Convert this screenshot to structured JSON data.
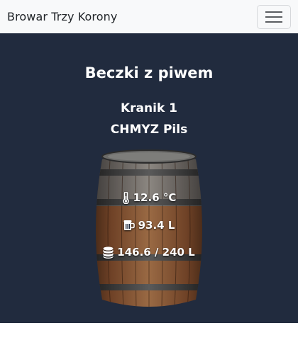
{
  "navbar": {
    "brand": "Browar Trzy Korony",
    "toggle_icon": "hamburger-menu-icon"
  },
  "main": {
    "title": "Beczki z piwem",
    "tap": {
      "name": "Kranik 1",
      "beer": "CHMYZ Pils",
      "temperature": "12.6 °C",
      "volume": "93.4 L",
      "capacity": "146.6 / 240 L",
      "icons": {
        "temperature": "thermometer-icon",
        "volume": "beer-mug-icon",
        "capacity": "database-icon",
        "keg": "barrel-image"
      }
    }
  },
  "colors": {
    "navbar_bg": "#f8f9fa",
    "page_bg": "#212b3e",
    "text": "#ffffff",
    "barrel_wood": "#7a4a2a",
    "barrel_hoop": "#4a4a4a"
  }
}
